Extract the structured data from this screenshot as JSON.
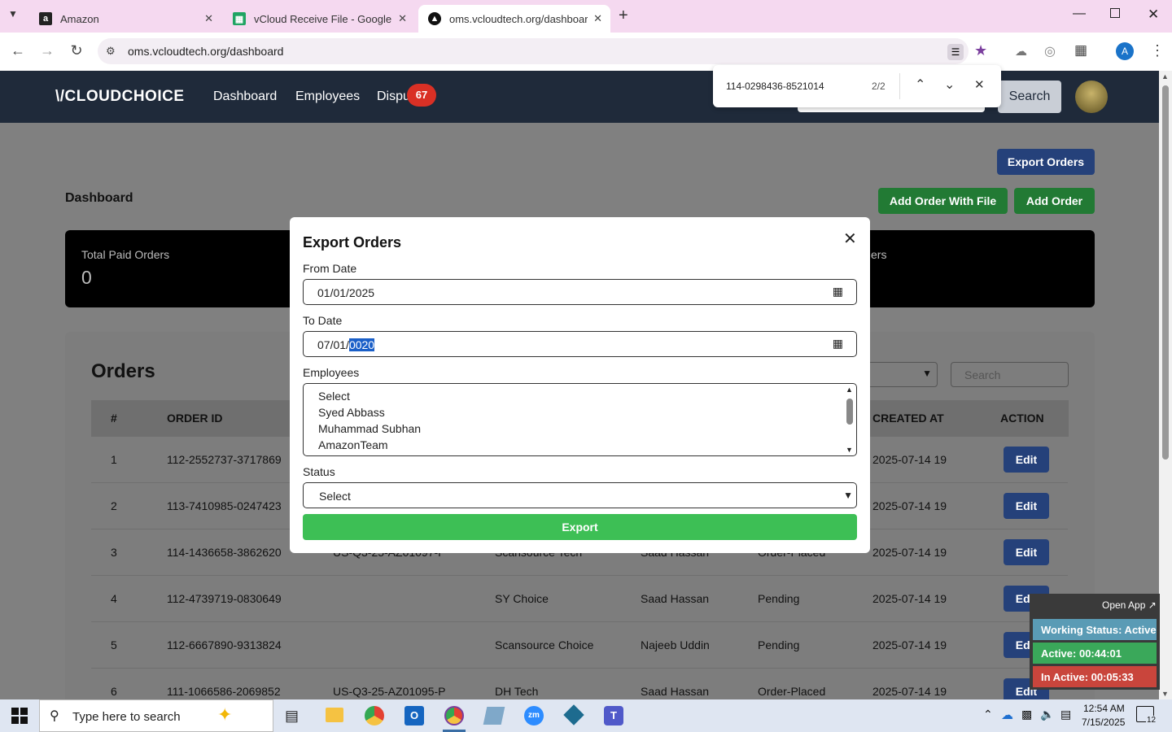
{
  "browser": {
    "tabs": [
      {
        "label": "Amazon",
        "icon": "amazon-icon"
      },
      {
        "label": "vCloud Receive File - Google Sh",
        "icon": "sheets-icon"
      },
      {
        "label": "oms.vcloudtech.org/dashboard",
        "icon": "site-icon"
      }
    ],
    "url": "oms.vcloudtech.org/dashboard",
    "profile_initial": "A"
  },
  "find": {
    "query": "114-0298436-8521014",
    "count": "2/2"
  },
  "app": {
    "logo": "\\/CLOUDCHOICE",
    "nav": [
      "Dashboard",
      "Employees",
      "Dispu"
    ],
    "nav_badge": "67",
    "search_button": "Search",
    "export_orders_button": "Export Orders",
    "add_order_file_button": "Add Order With File",
    "add_order_button": "Add Order",
    "page_title": "Dashboard",
    "cards": {
      "paid_label": "Total Paid Orders",
      "paid_value": "0",
      "right_label_fragment": "ers"
    },
    "orders": {
      "title": "Orders",
      "search_placeholder": "Search",
      "headers": [
        "#",
        "ORDER ID",
        "CREATED AT",
        "ACTION"
      ],
      "edit_label": "Edit",
      "rows": [
        {
          "n": "1",
          "order_id": "112-2552737-3717869",
          "ref": "",
          "vendor": "",
          "employee": "",
          "status": "",
          "created": "2025-07-14 19"
        },
        {
          "n": "2",
          "order_id": "113-7410985-0247423",
          "ref": "",
          "vendor": "",
          "employee": "",
          "status": "",
          "created": "2025-07-14 19"
        },
        {
          "n": "3",
          "order_id": "114-1436658-3862620",
          "ref": "US-Q3-25-AZ01097-P",
          "vendor": "Scansource Tech",
          "employee": "Saad Hassan",
          "status": "Order-Placed",
          "created": "2025-07-14 19"
        },
        {
          "n": "4",
          "order_id": "112-4739719-0830649",
          "ref": "",
          "vendor": "SY Choice",
          "employee": "Saad Hassan",
          "status": "Pending",
          "created": "2025-07-14 19"
        },
        {
          "n": "5",
          "order_id": "112-6667890-9313824",
          "ref": "",
          "vendor": "Scansource Choice",
          "employee": "Najeeb Uddin",
          "status": "Pending",
          "created": "2025-07-14 19"
        },
        {
          "n": "6",
          "order_id": "111-1066586-2069852",
          "ref": "US-Q3-25-AZ01095-P",
          "vendor": "DH Tech",
          "employee": "Saad Hassan",
          "status": "Order-Placed",
          "created": "2025-07-14 19"
        }
      ]
    }
  },
  "modal": {
    "title": "Export Orders",
    "from_label": "From Date",
    "from_value": "01/01/2025",
    "to_label": "To Date",
    "to_value_prefix": "07/01/",
    "to_value_selected": "0020",
    "employees_label": "Employees",
    "employees": [
      "Select",
      "Syed Abbass",
      "Muhammad Subhan",
      "AmazonTeam"
    ],
    "status_label": "Status",
    "status_value": "Select",
    "export_button": "Export"
  },
  "widget": {
    "open_app": "Open App ↗",
    "working": "Working Status: Active",
    "active": "Active: 00:44:01",
    "inactive": "In Active: 00:05:33"
  },
  "taskbar": {
    "search_placeholder": "Type here to search",
    "time": "12:54 AM",
    "date": "7/15/2025",
    "notifications": "12"
  },
  "colors": {
    "tabbar": "#f5d9f0",
    "navbar": "#1f2a3a",
    "green": "#3dbf55",
    "blue_btn": "#25417a",
    "badge_red": "#d93025"
  }
}
